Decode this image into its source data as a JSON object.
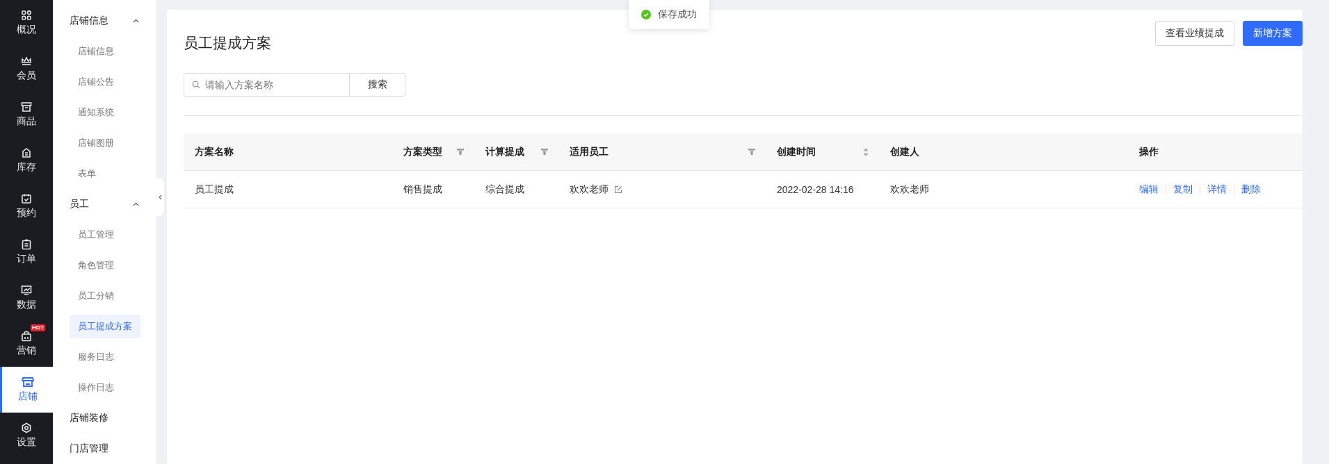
{
  "rail": {
    "items": [
      {
        "label": "概况",
        "selected": false
      },
      {
        "label": "会员",
        "selected": false
      },
      {
        "label": "商品",
        "selected": false
      },
      {
        "label": "库存",
        "selected": false
      },
      {
        "label": "预约",
        "selected": false
      },
      {
        "label": "订单",
        "selected": false
      },
      {
        "label": "数据",
        "selected": false
      },
      {
        "label": "营销",
        "selected": false,
        "badge": "HOT"
      },
      {
        "label": "店铺",
        "selected": true
      },
      {
        "label": "设置",
        "selected": false
      }
    ]
  },
  "sidebar": {
    "items": [
      {
        "kind": "group",
        "label": "店铺信息",
        "expanded": true,
        "children": [
          {
            "label": "店铺信息",
            "selected": false
          },
          {
            "label": "店铺公告",
            "selected": false
          },
          {
            "label": "通知系统",
            "selected": false
          },
          {
            "label": "店铺图册",
            "selected": false
          },
          {
            "label": "表单",
            "selected": false
          }
        ]
      },
      {
        "kind": "group",
        "label": "员工",
        "expanded": true,
        "children": [
          {
            "label": "员工管理",
            "selected": false
          },
          {
            "label": "角色管理",
            "selected": false
          },
          {
            "label": "员工分销",
            "selected": false
          },
          {
            "label": "员工提成方案",
            "selected": true
          },
          {
            "label": "服务日志",
            "selected": false
          },
          {
            "label": "操作日志",
            "selected": false
          }
        ]
      },
      {
        "kind": "link",
        "label": "店铺装修"
      },
      {
        "kind": "link",
        "label": "门店管理"
      }
    ]
  },
  "toast": {
    "text": "保存成功"
  },
  "page": {
    "title": "员工提成方案",
    "buttons": [
      {
        "label": "查看业绩提成",
        "kind": "default"
      },
      {
        "label": "新增方案",
        "kind": "primary"
      }
    ]
  },
  "search": {
    "placeholder": "请输入方案名称",
    "button": "搜索"
  },
  "table": {
    "columns": [
      {
        "label": "方案名称",
        "kind": "plain"
      },
      {
        "label": "方案类型",
        "kind": "filter"
      },
      {
        "label": "计算提成",
        "kind": "filter"
      },
      {
        "label": "适用员工",
        "kind": "filter"
      },
      {
        "label": "创建时间",
        "kind": "sort"
      },
      {
        "label": "创建人",
        "kind": "plain"
      },
      {
        "label": "操作",
        "kind": "plain"
      }
    ],
    "rows": [
      {
        "cells": [
          "员工提成",
          "销售提成",
          "综合提成",
          "欢欢老师",
          "2022-02-28 14:16",
          "欢欢老师"
        ],
        "actions": [
          "编辑",
          "复制",
          "详情",
          "删除"
        ]
      }
    ]
  }
}
